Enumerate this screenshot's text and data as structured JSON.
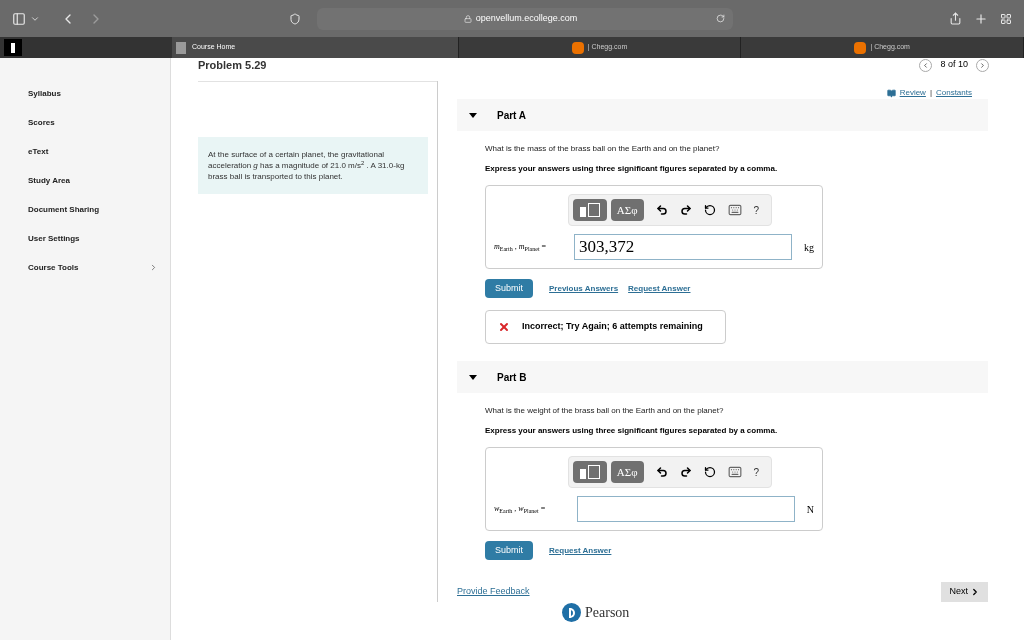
{
  "browser": {
    "url": "openvellum.ecollege.com",
    "back_disabled": false,
    "forward_disabled": true
  },
  "tabs": [
    {
      "label": "Course Home",
      "kind": "course",
      "selected": true
    },
    {
      "label": "| Chegg.com",
      "kind": "chegg",
      "selected": false
    },
    {
      "label": "| Chegg.com",
      "kind": "chegg",
      "selected": false
    }
  ],
  "sidebar": {
    "items": [
      {
        "label": "Syllabus",
        "has_children": false
      },
      {
        "label": "Scores",
        "has_children": false
      },
      {
        "label": "eText",
        "has_children": false
      },
      {
        "label": "Study Area",
        "has_children": false
      },
      {
        "label": "Document Sharing",
        "has_children": false
      },
      {
        "label": "User Settings",
        "has_children": false
      },
      {
        "label": "Course Tools",
        "has_children": true
      }
    ]
  },
  "problem": {
    "title": "Problem 5.29",
    "pager": "8 of 10",
    "statement": "At the surface of a certain planet, the gravitational acceleration *g* has a magnitude of 21.0 m/s$^{2}$ . A 31.0-kg brass ball is transported to this planet.",
    "links": [
      "Review",
      "Constants"
    ],
    "link_separator": "|"
  },
  "parts": [
    {
      "title": "Part A",
      "expanded": true,
      "question": "What is the mass of the brass ball on the Earth and on the planet?",
      "instruction": "Express your answers using three significant figures separated by a comma.",
      "toolbar": [
        "ΑΣφ",
        "?"
      ],
      "label": "*m*$_{Earth}$ , *m*$_{Planet}$ =",
      "value": "303,372",
      "unit": "kg",
      "submit": "Submit",
      "links": [
        "Previous Answers",
        "Request Answer"
      ],
      "feedback": "Incorrect; Try Again; 6 attempts remaining"
    },
    {
      "title": "Part B",
      "expanded": true,
      "question": "What is the weight of the brass ball on the Earth and on the planet?",
      "instruction": "Express your answers using three significant figures separated by a comma.",
      "toolbar": [
        "ΑΣφ",
        "?"
      ],
      "label": "*w*$_{Earth}$ , *w*$_{Planet}$ =",
      "unit": "N",
      "submit": "Submit",
      "links": [
        "Request Answer"
      ]
    }
  ],
  "footer": {
    "feedback_link": "Provide Feedback",
    "next": "Next",
    "brand": "Pearson"
  }
}
